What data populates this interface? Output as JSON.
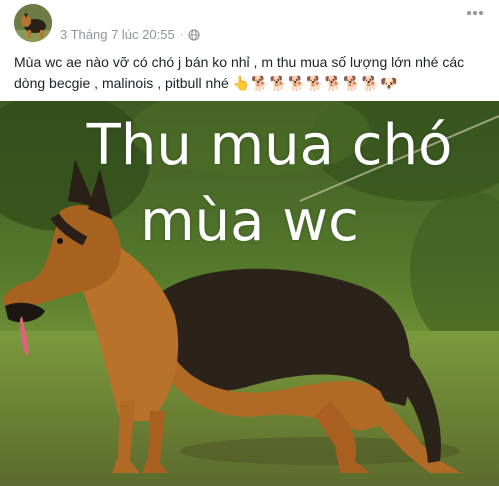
{
  "post": {
    "timestamp": "3 Tháng 7 lúc 20:55",
    "separator": "·",
    "privacy_icon": "globe-icon",
    "more_icon": "more-options-icon",
    "message_line1": "Mùa wc ae nào vỡ có chó j bán ko nhỉ , m thu mua số lượng lớn nhé các",
    "message_line2": "dòng becgie , malinois , pitbull nhé",
    "emojis": "👆🐕🐕🐕🐕🐕🐕🐕🐶",
    "image": {
      "subject": "german-shepherd-dog",
      "caption_line1": "Thu mua chó",
      "caption_line2": "mùa wc"
    }
  },
  "colors": {
    "meta_text": "#90949c",
    "message_text": "#1d2129",
    "caption_text": "#ffffff"
  }
}
